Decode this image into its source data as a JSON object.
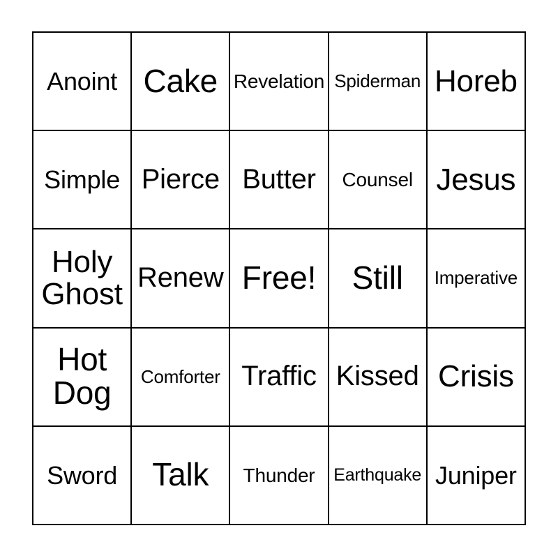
{
  "card": {
    "type": "bingo-card",
    "columns": 5,
    "rows": 5,
    "free_space_index": 12,
    "border_color": "#000000",
    "background_color": "#ffffff",
    "text_color": "#000000",
    "cells": [
      {
        "text": "Anoint",
        "size": "sm",
        "lines": 1
      },
      {
        "text": "Cake",
        "size": "xl",
        "lines": 1
      },
      {
        "text": "Revelation",
        "size": "xs",
        "lines": 1
      },
      {
        "text": "Spiderman",
        "size": "xxs",
        "lines": 1
      },
      {
        "text": "Horeb",
        "size": "lg",
        "lines": 1
      },
      {
        "text": "Simple",
        "size": "sm",
        "lines": 1
      },
      {
        "text": "Pierce",
        "size": "md",
        "lines": 1
      },
      {
        "text": "Butter",
        "size": "md",
        "lines": 1
      },
      {
        "text": "Counsel",
        "size": "xs",
        "lines": 1
      },
      {
        "text": "Jesus",
        "size": "lg",
        "lines": 1
      },
      {
        "text": "Holy\nGhost",
        "size": "lg",
        "lines": 2
      },
      {
        "text": "Renew",
        "size": "md",
        "lines": 1
      },
      {
        "text": "Free!",
        "size": "xl",
        "lines": 1
      },
      {
        "text": "Still",
        "size": "xl",
        "lines": 1
      },
      {
        "text": "Imperative",
        "size": "xxs",
        "lines": 1
      },
      {
        "text": "Hot\nDog",
        "size": "xl",
        "lines": 2
      },
      {
        "text": "Comforter",
        "size": "xxs",
        "lines": 1
      },
      {
        "text": "Traffic",
        "size": "md",
        "lines": 1
      },
      {
        "text": "Kissed",
        "size": "md",
        "lines": 1
      },
      {
        "text": "Crisis",
        "size": "lg",
        "lines": 1
      },
      {
        "text": "Sword",
        "size": "sm",
        "lines": 1
      },
      {
        "text": "Talk",
        "size": "xl",
        "lines": 1
      },
      {
        "text": "Thunder",
        "size": "xs",
        "lines": 1
      },
      {
        "text": "Earthquake",
        "size": "min",
        "lines": 1
      },
      {
        "text": "Juniper",
        "size": "sm",
        "lines": 1
      }
    ]
  }
}
